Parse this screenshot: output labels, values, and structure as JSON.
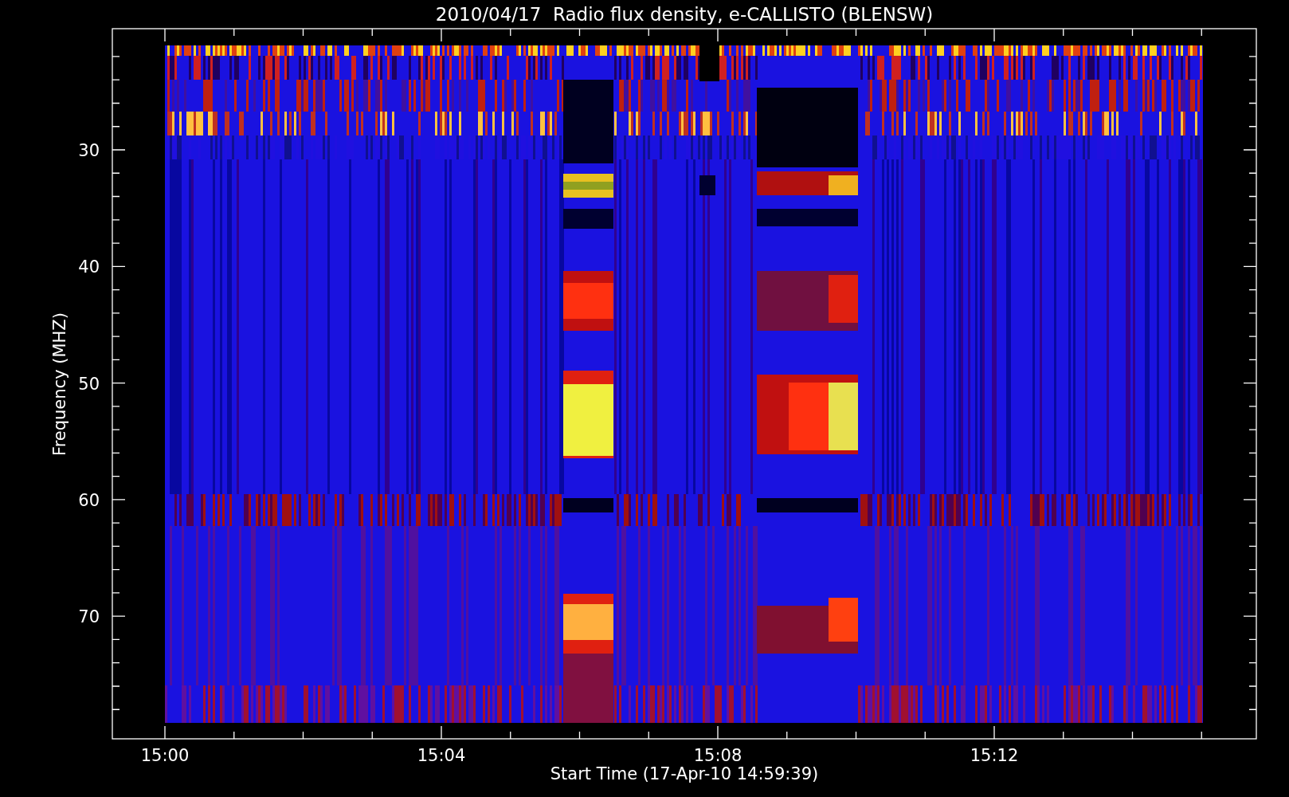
{
  "plot": {
    "title": "2010/04/17  Radio flux density, e-CALLISTO (BLENSW)",
    "ylabel": "Frequency (MHZ)",
    "xlabel": "Start Time (17-Apr-10 14:59:39)",
    "yticks": [
      "30",
      "40",
      "50",
      "60",
      "70"
    ],
    "xticks": [
      "15:00",
      "15:04",
      "15:08",
      "15:12"
    ]
  }
}
